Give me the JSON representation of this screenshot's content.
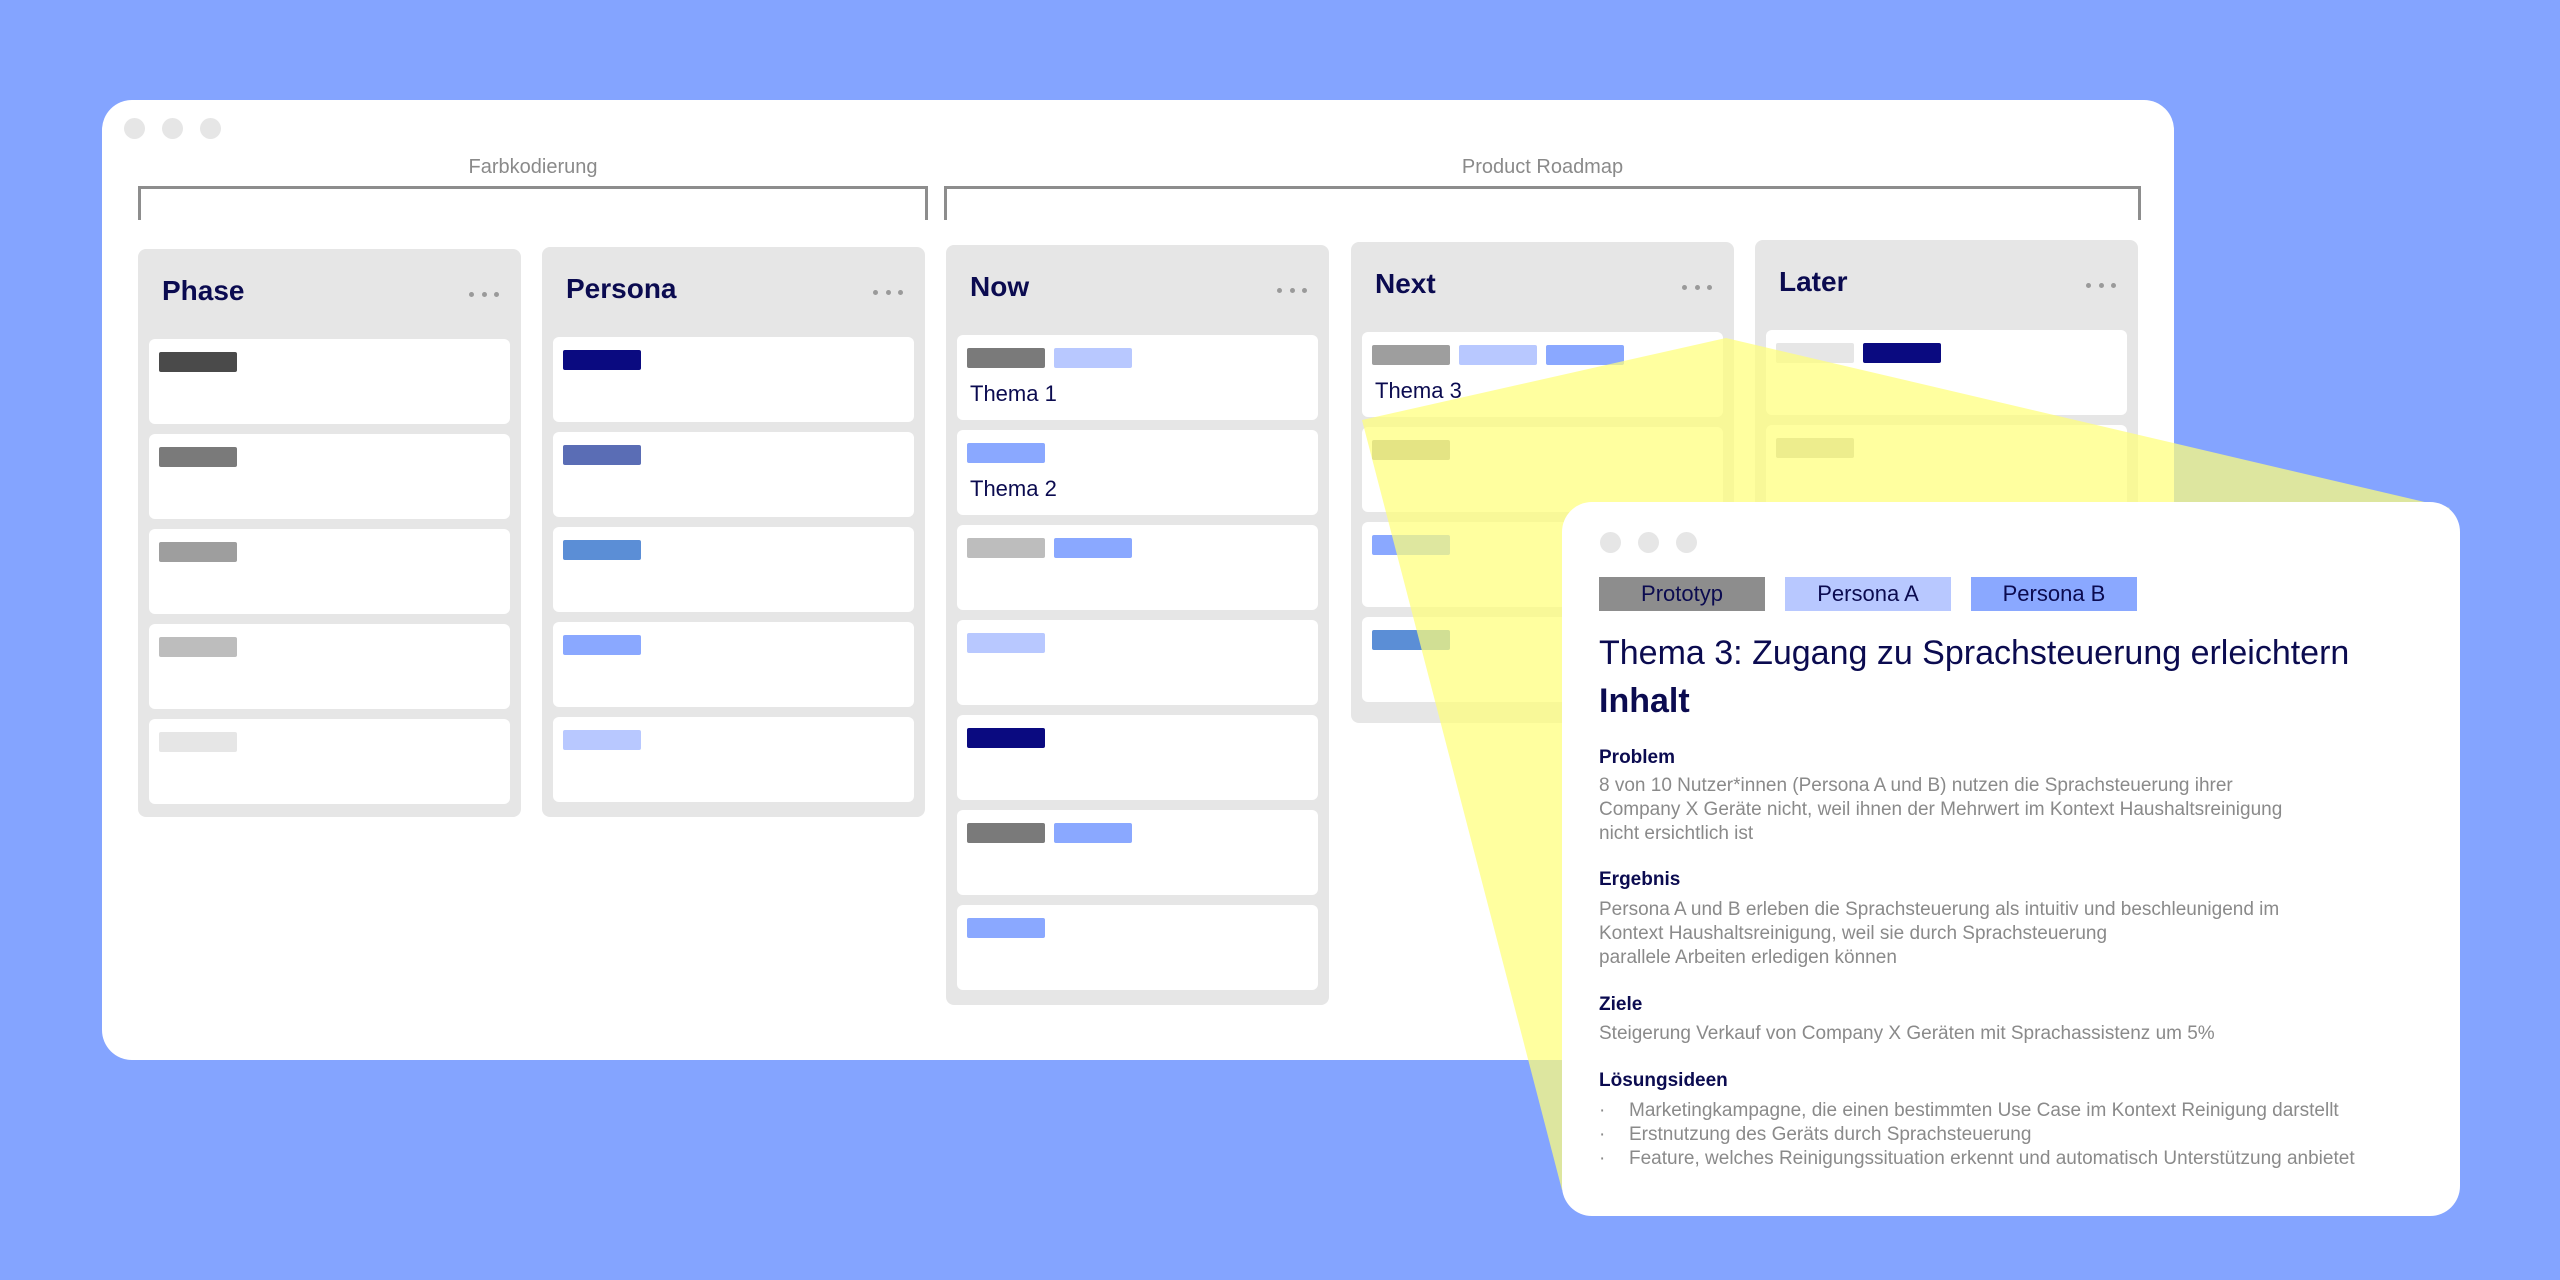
{
  "board": {
    "groups": [
      {
        "label": "Farbkodierung"
      },
      {
        "label": "Product Roadmap"
      }
    ],
    "columns": [
      {
        "title": "Phase",
        "cards": [
          {
            "tags": [
              "#4a4a4a"
            ]
          },
          {
            "tags": [
              "#7a7a7a"
            ]
          },
          {
            "tags": [
              "#9e9e9e"
            ]
          },
          {
            "tags": [
              "#bdbdbd"
            ]
          },
          {
            "tags": [
              "#e6e6e6"
            ]
          }
        ]
      },
      {
        "title": "Persona",
        "cards": [
          {
            "tags": [
              "#0a0a80"
            ]
          },
          {
            "tags": [
              "#5a6db5"
            ]
          },
          {
            "tags": [
              "#5b8ed6"
            ]
          },
          {
            "tags": [
              "#8aa8ff"
            ]
          },
          {
            "tags": [
              "#b8c8ff"
            ]
          }
        ]
      },
      {
        "title": "Now",
        "cards": [
          {
            "tags": [
              "#7a7a7a",
              "#b8c8ff"
            ],
            "title": "Thema 1"
          },
          {
            "tags": [
              "#8aa8ff"
            ],
            "title": "Thema 2"
          },
          {
            "tags": [
              "#bdbdbd",
              "#8aa8ff"
            ]
          },
          {
            "tags": [
              "#b8c8ff"
            ]
          },
          {
            "tags": [
              "#0a0a80"
            ]
          },
          {
            "tags": [
              "#7a7a7a",
              "#8aa8ff"
            ]
          },
          {
            "tags": [
              "#8aa8ff"
            ]
          }
        ]
      },
      {
        "title": "Next",
        "cards": [
          {
            "tags": [
              "#9e9e9e",
              "#b8c8ff",
              "#8aa8ff"
            ],
            "title": "Thema 3"
          },
          {
            "tags": [
              "#9e9e9e"
            ]
          },
          {
            "tags": [
              "#8aa8ff"
            ]
          },
          {
            "tags": [
              "#5b8ed6"
            ]
          }
        ]
      },
      {
        "title": "Later",
        "cards": [
          {
            "tags": [
              "#e6e6e6",
              "#0a0a80"
            ]
          },
          {
            "tags": [
              "#bdbdbd"
            ]
          }
        ]
      }
    ]
  },
  "detail": {
    "tags": [
      {
        "label": "Prototyp",
        "color": "#8d8d8d"
      },
      {
        "label": "Persona A",
        "color": "#b8c8ff"
      },
      {
        "label": "Persona B",
        "color": "#8aa8ff"
      }
    ],
    "title": "Thema 3: Zugang zu Sprachsteuerung erleichtern",
    "subtitle": "Inhalt",
    "problem": {
      "heading": "Problem",
      "lines": [
        "8 von 10 Nutzer*innen (Persona A und B) nutzen die Sprachsteuerung ihrer",
        "Company X Geräte nicht, weil ihnen der Mehrwert im Kontext Haushaltsreinigung",
        "nicht ersichtlich ist"
      ]
    },
    "ergebnis": {
      "heading": "Ergebnis",
      "lines": [
        "Persona A und B erleben die Sprachsteuerung als intuitiv und beschleunigend im",
        "Kontext Haushaltsreinigung, weil sie durch Sprachsteuerung",
        "parallele Arbeiten erledigen können"
      ]
    },
    "ziele": {
      "heading": "Ziele",
      "lines": [
        "Steigerung Verkauf von Company X Geräten mit Sprachassistenz um 5%"
      ]
    },
    "loesungsideen": {
      "heading": "Lösungsideen",
      "bullet_mark": "·",
      "items": [
        "Marketingkampagne, die einen bestimmten Use Case im Kontext Reinigung darstellt",
        "Erstnutzung des Geräts durch Sprachsteuerung",
        "Feature, welches Reinigungssituation erkennt und automatisch Unterstützung anbietet"
      ]
    }
  },
  "colors": {
    "background": "#84a4ff",
    "highlight": "#ffff7a",
    "navy": "#0b0b50"
  }
}
